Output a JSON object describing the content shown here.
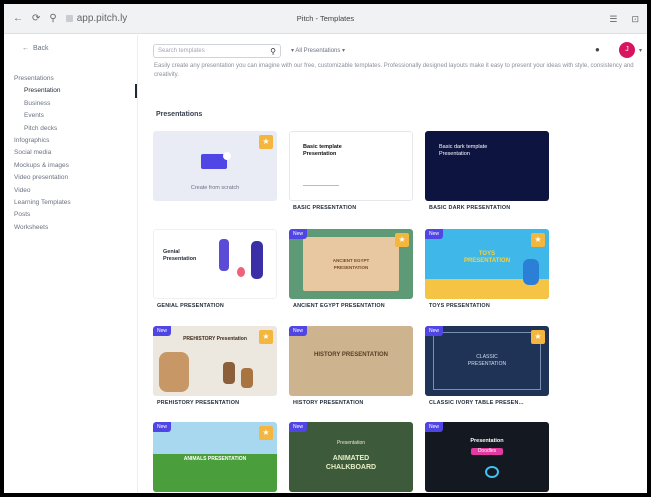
{
  "browser": {
    "back_glyph": "←",
    "forward_glyph": "⟳",
    "extra_glyph": "⚲",
    "url": "app.pitch.ly",
    "title": "Pitch - Templates",
    "right_glyph_1": "☰",
    "right_glyph_2": "⊡"
  },
  "sidebar": {
    "back_label": "Back",
    "items": [
      {
        "label": "Presentations",
        "sub": false,
        "active": false
      },
      {
        "label": "Presentation",
        "sub": true,
        "active": true
      },
      {
        "label": "Business",
        "sub": true,
        "active": false
      },
      {
        "label": "Events",
        "sub": true,
        "active": false
      },
      {
        "label": "Pitch decks",
        "sub": true,
        "active": false
      },
      {
        "label": "Infographics",
        "sub": false,
        "active": false
      },
      {
        "label": "Social media",
        "sub": false,
        "active": false
      },
      {
        "label": "Mockups & images",
        "sub": false,
        "active": false
      },
      {
        "label": "Video presentation",
        "sub": false,
        "active": false
      },
      {
        "label": "Video",
        "sub": false,
        "active": false
      },
      {
        "label": "Learning Templates",
        "sub": false,
        "active": false
      },
      {
        "label": "Posts",
        "sub": false,
        "active": false
      },
      {
        "label": "Worksheets",
        "sub": false,
        "active": false
      }
    ]
  },
  "topbar": {
    "search_placeholder": "Search templates",
    "search_icon": "search-icon",
    "filter_label": "▾ All Presentations ▾",
    "avatar_initial": "J"
  },
  "content": {
    "description": "Easily create any presentation you can imagine with our free, customizable templates. Professionally designed layouts make it easy to present your ideas with style, consistency and creativity.",
    "section_title": "Presentations"
  },
  "cards": [
    {
      "caption": "",
      "new": false,
      "star": true,
      "kind": "create",
      "create_label": "Create from scratch"
    },
    {
      "caption": "BASIC PRESENTATION",
      "new": false,
      "star": false,
      "kind": "basic",
      "thumb_title": "Basic template Presentation"
    },
    {
      "caption": "BASIC DARK PRESENTATION",
      "new": false,
      "star": false,
      "kind": "dark",
      "thumb_title": "Basic dark template Presentation"
    },
    {
      "caption": "GENIAL PRESENTATION",
      "new": false,
      "star": false,
      "kind": "genial",
      "thumb_title": "Genial Presentation"
    },
    {
      "caption": "ANCIENT EGYPT PRESENTATION",
      "new": true,
      "star": true,
      "kind": "egypt",
      "thumb_title": "ANCIENT EGYPT PRESENTATION"
    },
    {
      "caption": "TOYS PRESENTATION",
      "new": true,
      "star": true,
      "kind": "toys",
      "thumb_title": "TOYS PRESENTATION"
    },
    {
      "caption": "PREHISTORY PRESENTATION",
      "new": true,
      "star": true,
      "kind": "prehistory",
      "thumb_title": "PREHISTORY Presentation"
    },
    {
      "caption": "HISTORY PRESENTATION",
      "new": true,
      "star": false,
      "kind": "history",
      "thumb_title": "HISTORY PRESENTATION"
    },
    {
      "caption": "CLASSIC IVORY TABLE PRESEN...",
      "new": true,
      "star": true,
      "kind": "classic",
      "thumb_title": "CLASSIC PRESENTATION"
    },
    {
      "caption": "",
      "new": true,
      "star": true,
      "kind": "animals",
      "thumb_title": "ANIMALS PRESENTATION"
    },
    {
      "caption": "",
      "new": true,
      "star": false,
      "kind": "chalk",
      "thumb_title": "ANIMATED CHALKBOARD",
      "thumb_sub": "Presentation"
    },
    {
      "caption": "",
      "new": true,
      "star": false,
      "kind": "doodle",
      "thumb_title": "Presentation",
      "thumb_sub": "Doodles"
    }
  ],
  "badges": {
    "new_label": "New",
    "star_glyph": "★"
  },
  "colors": {
    "accent": "#4f46e5",
    "star": "#f4b63c",
    "avatar": "#d6145f"
  }
}
